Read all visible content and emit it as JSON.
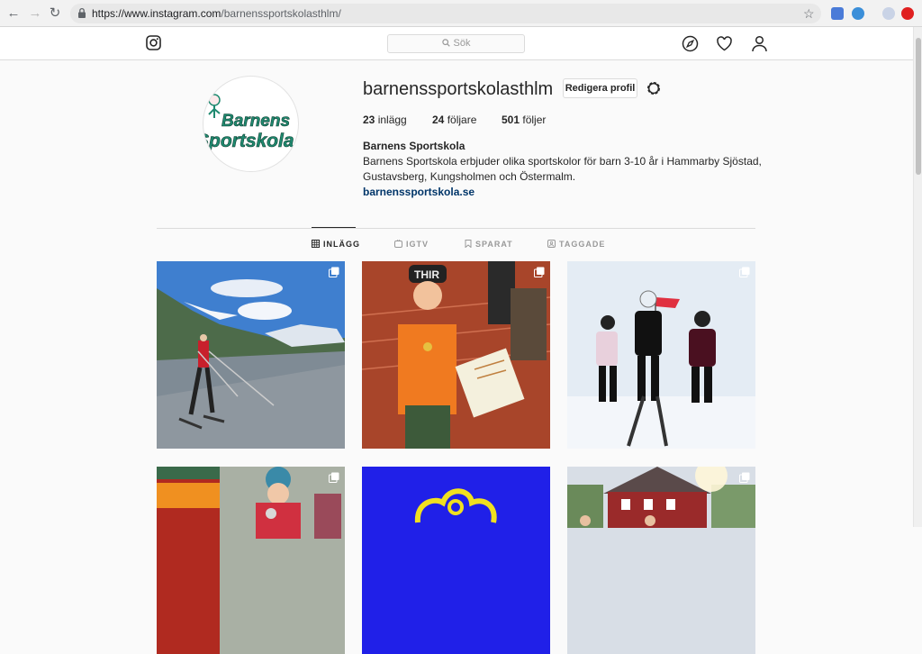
{
  "browser": {
    "url_host": "https://www.instagram.com",
    "url_path": "/barnenssportskolasthlm/"
  },
  "header": {
    "search_placeholder": "Sök"
  },
  "profile": {
    "username": "barnenssportskolasthlm",
    "edit_label": "Redigera profil",
    "posts_count": "23",
    "posts_label": "inlägg",
    "followers_count": "24",
    "followers_label": "följare",
    "following_count": "501",
    "following_label": "följer",
    "full_name": "Barnens Sportskola",
    "bio": "Barnens Sportskola erbjuder olika sportskolor för barn 3-10 år i Hammarby Sjöstad, Gustavsberg, Kungsholmen och Östermalm.",
    "website": "barnenssportskola.se",
    "avatar_text_line1": "Barnens",
    "avatar_text_line2": "Sportskola"
  },
  "tabs": [
    {
      "label": "INLÄGG",
      "icon": "grid-icon",
      "active": true
    },
    {
      "label": "IGTV",
      "icon": "igtv-icon",
      "active": false
    },
    {
      "label": "SPARAT",
      "icon": "bookmark-icon",
      "active": false
    },
    {
      "label": "TAGGADE",
      "icon": "tag-icon",
      "active": false
    }
  ],
  "posts": [
    {
      "subject": "skiroller-mountain",
      "badge": "carousel-icon"
    },
    {
      "subject": "child-with-medal",
      "badge": "carousel-icon"
    },
    {
      "subject": "ski-school-snow",
      "badge": "carousel-icon"
    },
    {
      "subject": "track-children",
      "badge": "carousel-icon"
    },
    {
      "subject": "blue-logo",
      "badge": ""
    },
    {
      "subject": "red-house-group",
      "badge": "carousel-icon"
    }
  ],
  "colors": {
    "link": "#003569",
    "text": "#262626",
    "muted": "#999999",
    "border": "#dbdbdb",
    "avatar_green": "#1f8a70"
  }
}
